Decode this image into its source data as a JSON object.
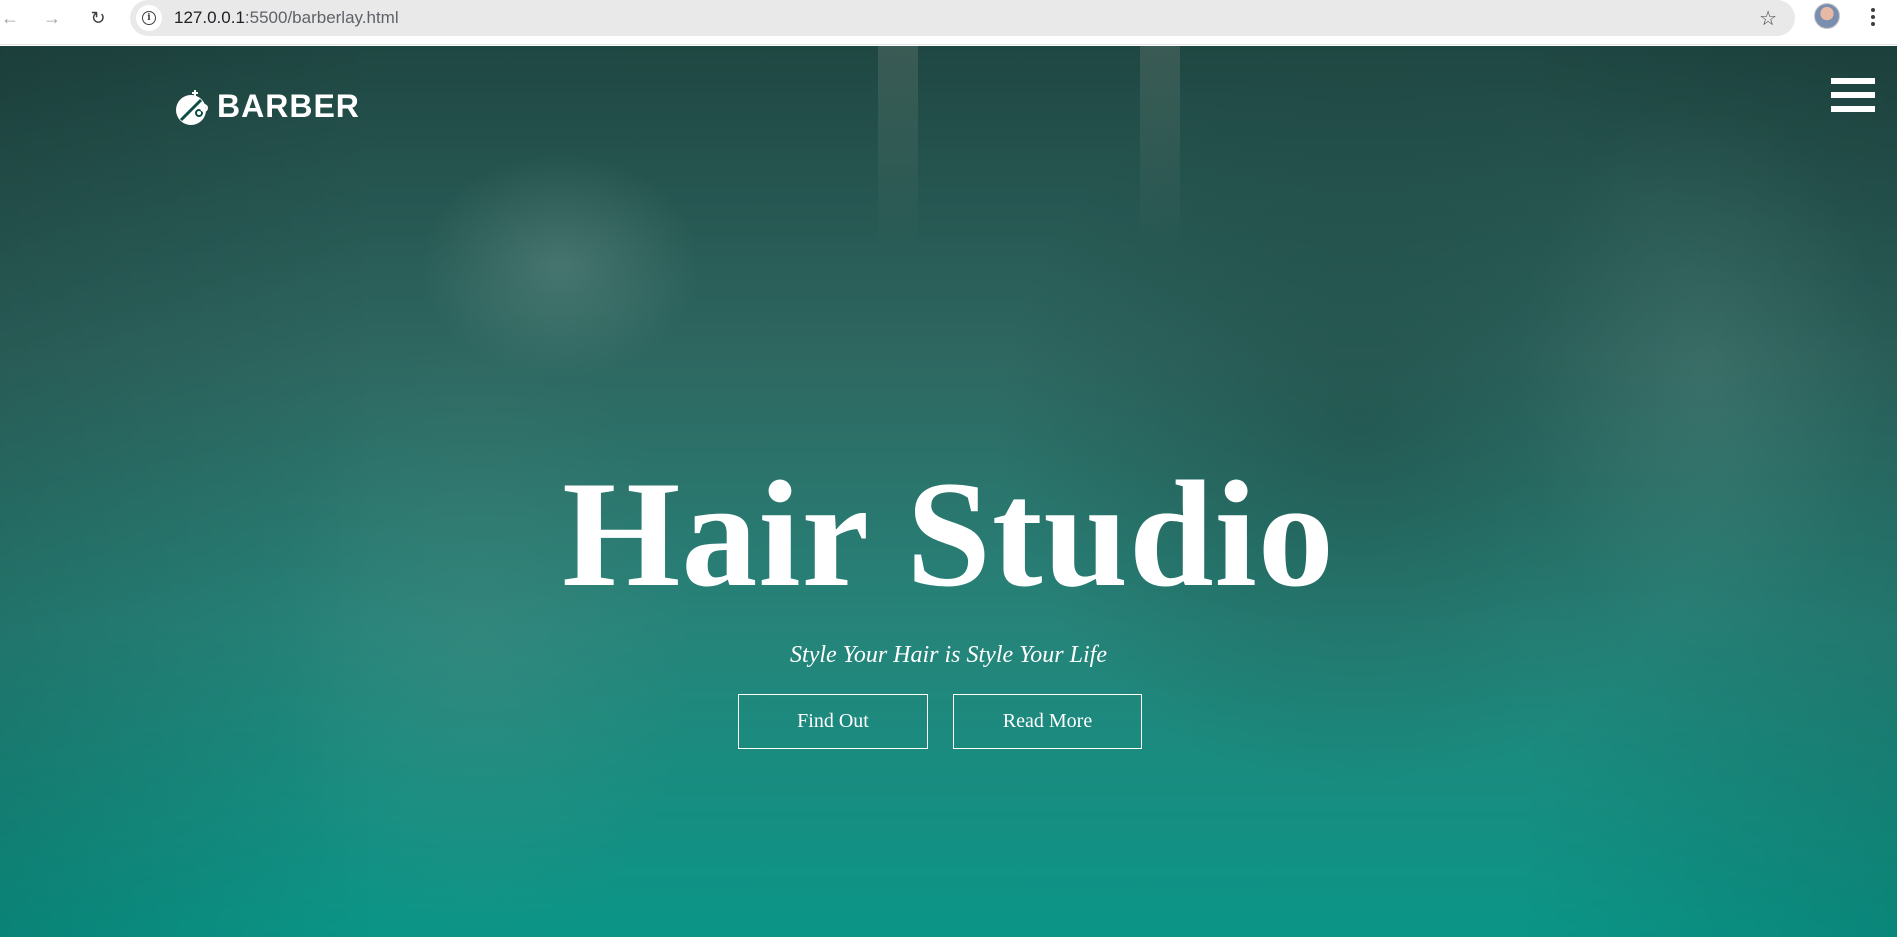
{
  "browser": {
    "url_host": "127.0.0.1",
    "url_path": ":5500/barberlay.html"
  },
  "header": {
    "logo_text": "BARBER"
  },
  "hero": {
    "title": "Hair Studio",
    "subtitle": "Style Your Hair is Style Your Life",
    "buttons": [
      {
        "label": "Find Out"
      },
      {
        "label": "Read More"
      }
    ]
  },
  "colors": {
    "hero_top": "#003a33",
    "hero_bottom": "#009384",
    "text": "#ffffff"
  },
  "icons": [
    "back-arrow-icon",
    "forward-arrow-icon",
    "reload-icon",
    "site-info-icon",
    "star-icon",
    "avatar",
    "more-vert-icon",
    "barber-logo-icon",
    "hamburger-menu-icon"
  ]
}
